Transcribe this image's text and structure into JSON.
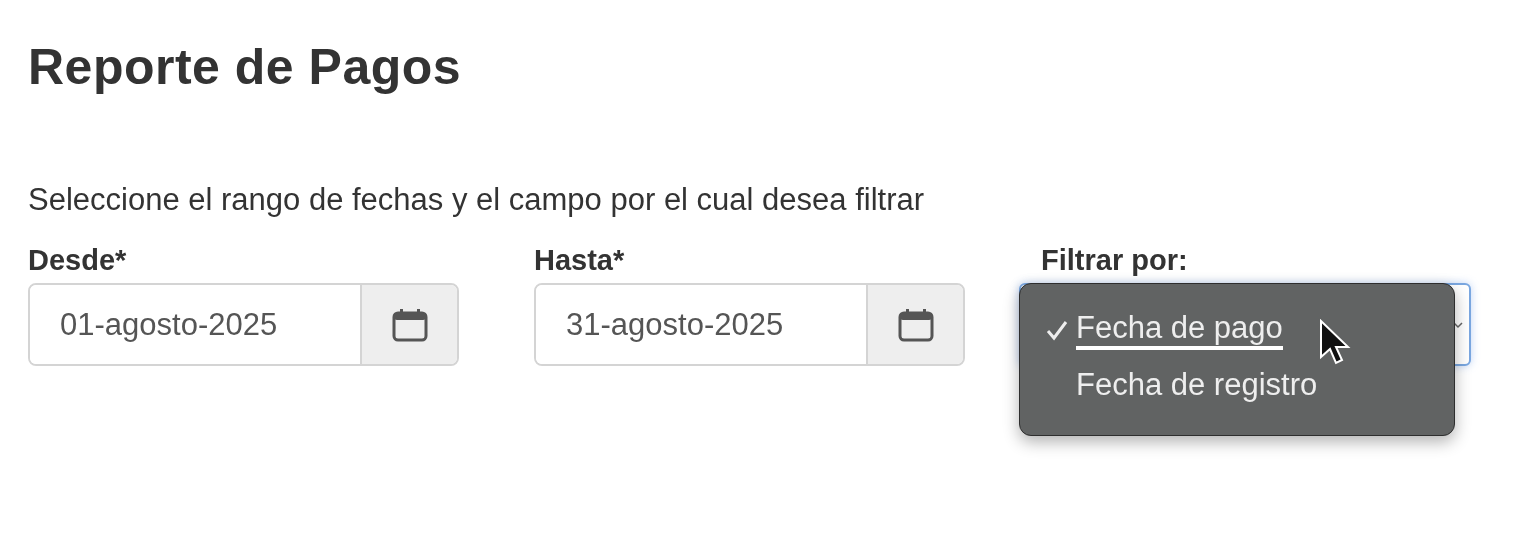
{
  "title": "Reporte de Pagos",
  "instructions": "Seleccione el rango de fechas y el campo por el cual desea filtrar",
  "date_fields": [
    {
      "label": "Desde*",
      "value": "01-agosto-2025"
    },
    {
      "label": "Hasta*",
      "value": "31-agosto-2025"
    }
  ],
  "filter": {
    "label": "Filtrar por:",
    "expanded": true,
    "options": [
      {
        "label": "Fecha de pago",
        "selected": true
      },
      {
        "label": "Fecha de registro",
        "selected": false
      }
    ]
  }
}
